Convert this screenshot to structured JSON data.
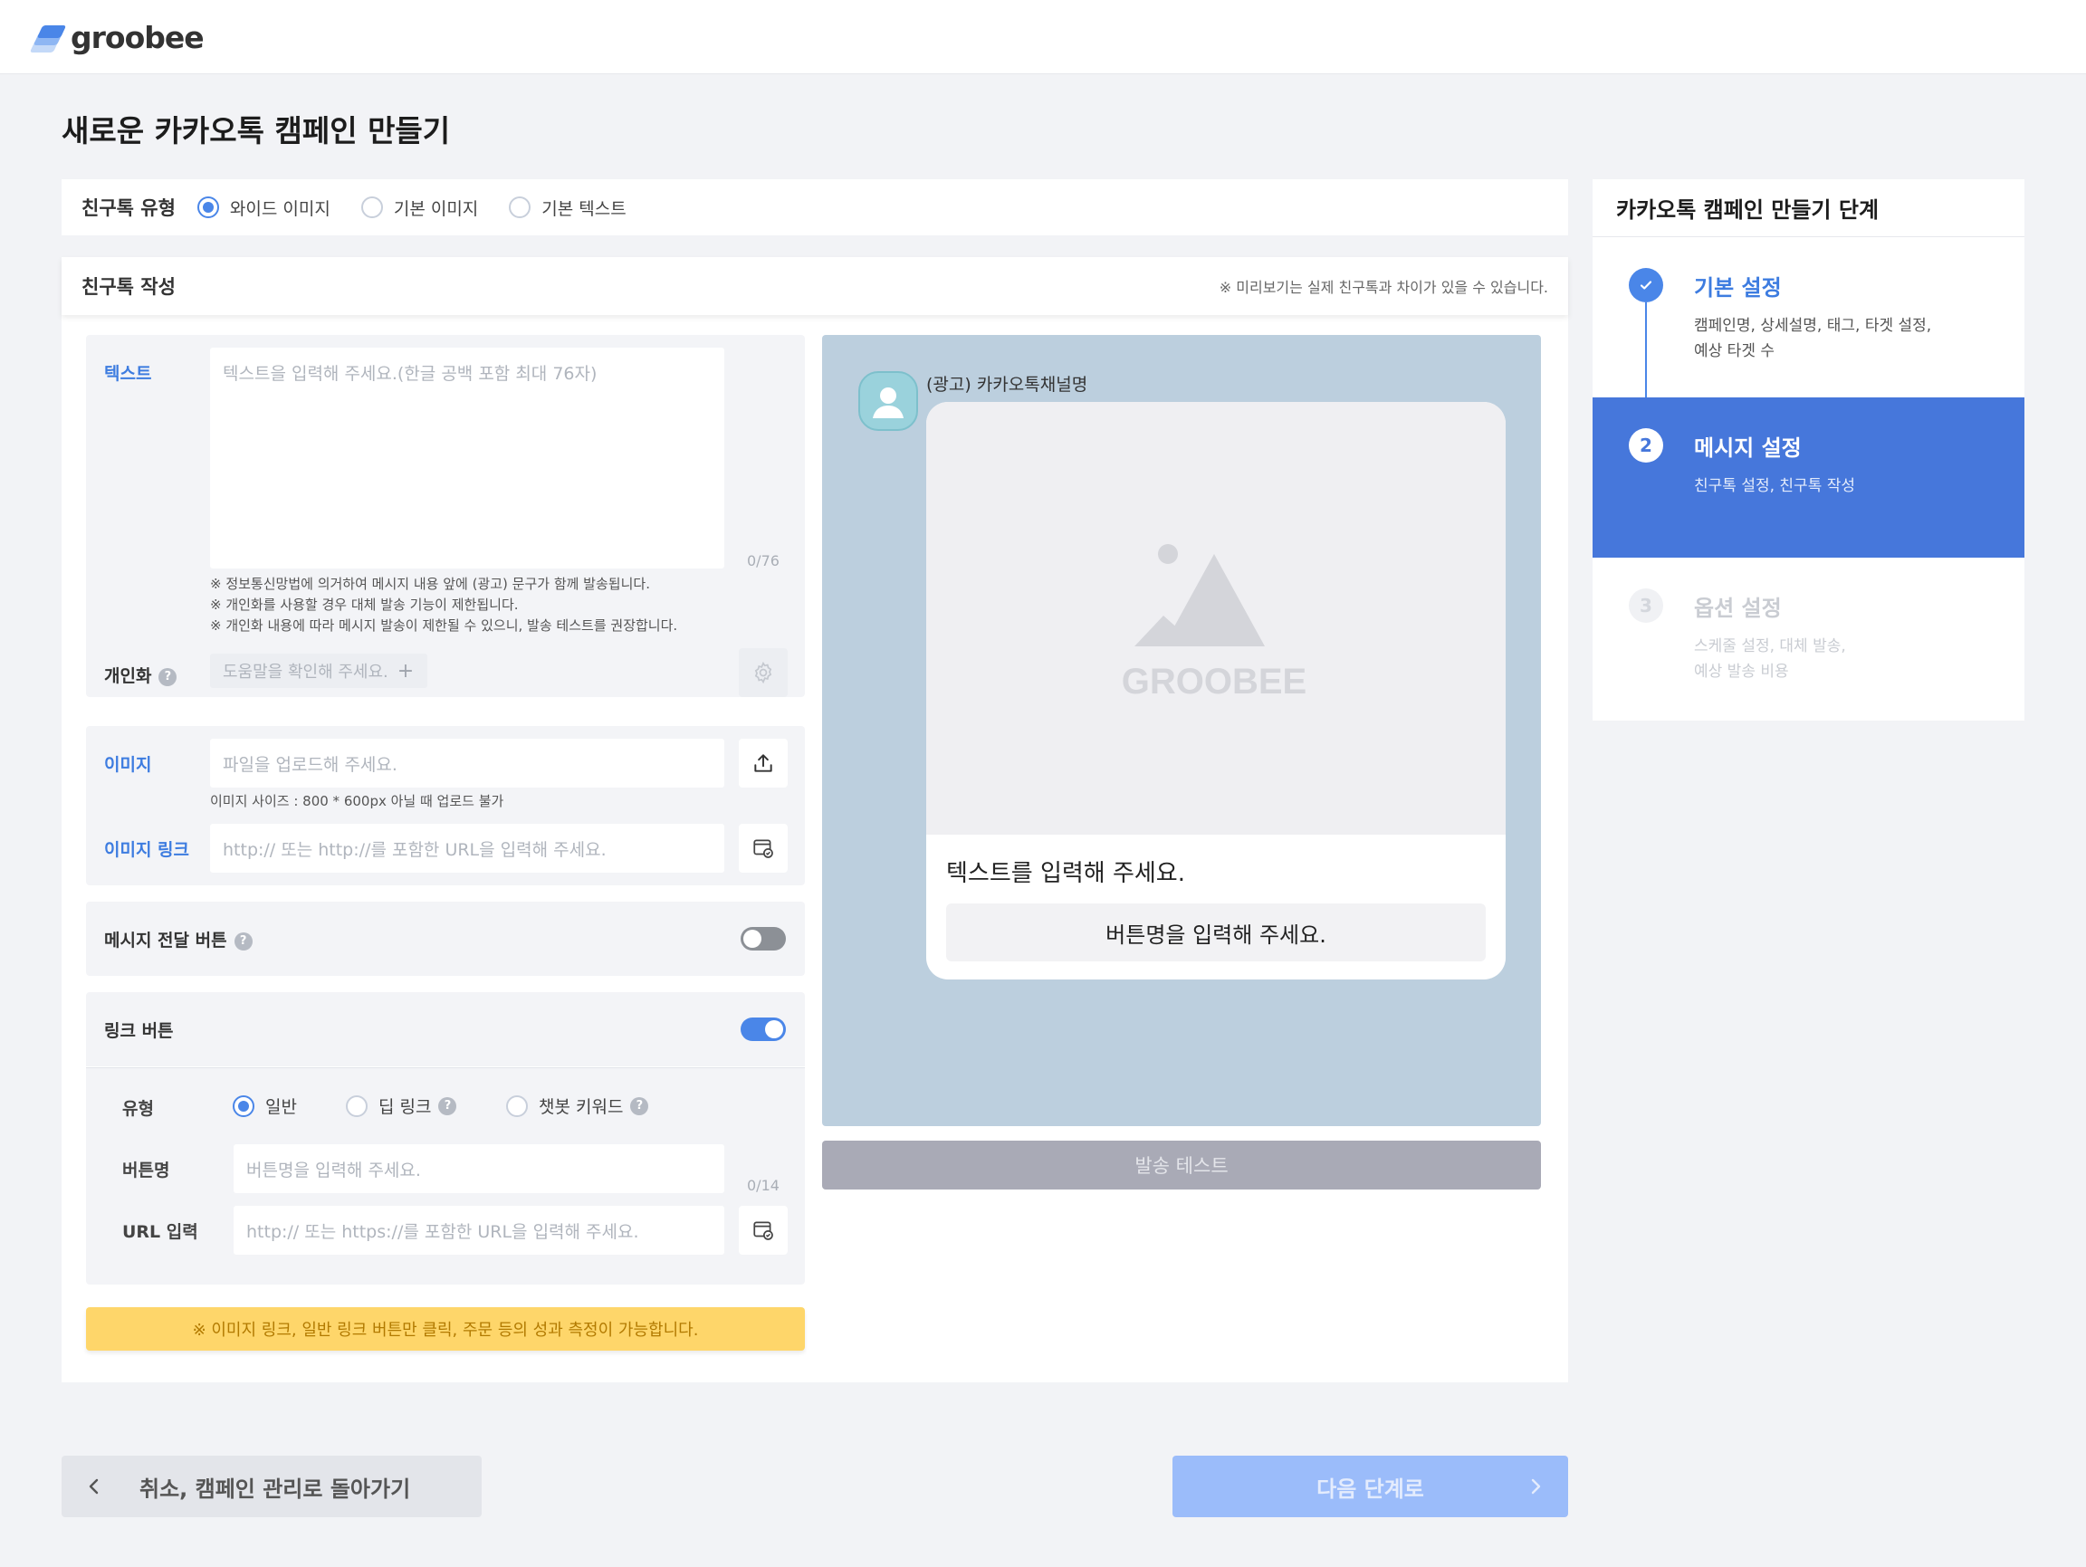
{
  "brand": {
    "name": "groobee"
  },
  "page": {
    "title": "새로운 카카오톡 캠페인 만들기"
  },
  "message_type": {
    "label": "친구톡 유형",
    "options": [
      "와이드 이미지",
      "기본 이미지",
      "기본 텍스트"
    ],
    "selected": "와이드 이미지"
  },
  "compose": {
    "title": "친구톡 작성",
    "preview_note": "※ 미리보기는 실제 친구톡과 차이가 있을 수 있습니다.",
    "text": {
      "label": "텍스트",
      "placeholder": "텍스트을 입력해 주세요.(한글 공백 포함 최대 76자)",
      "counter": "0/76",
      "notes": [
        "※ 정보통신망법에 의거하여 메시지 내용 앞에 (광고) 문구가 함께 발송됩니다.",
        "※ 개인화를 사용할 경우 대체 발송 기능이 제한됩니다.",
        "※ 개인화 내용에 따라 메시지 발송이 제한될 수 있으니, 발송 테스트를 권장합니다."
      ]
    },
    "personalization": {
      "label": "개인화",
      "help": "?",
      "placeholder": "도움말을 확인해 주세요.",
      "add_symbol": "+"
    },
    "image": {
      "label": "이미지",
      "placeholder": "파일을 업로드해 주세요.",
      "note": "이미지 사이즈 : 800 * 600px 아닐 때 업로드 불가"
    },
    "image_link": {
      "label": "이미지 링크",
      "placeholder": "http:// 또는 http://를 포함한 URL을 입력해 주세요."
    },
    "message_button": {
      "label": "메시지 전달 버튼",
      "help": "?",
      "enabled": false
    },
    "link_button": {
      "label": "링크 버튼",
      "enabled": true,
      "type_label": "유형",
      "types": [
        {
          "label": "일반",
          "help": ""
        },
        {
          "label": "딥 링크",
          "help": "?"
        },
        {
          "label": "챗봇 키워드",
          "help": "?"
        }
      ],
      "selected_type": "일반",
      "name_label": "버튼명",
      "name_placeholder": "버튼명을 입력해 주세요.",
      "name_counter": "0/14",
      "url_label": "URL 입력",
      "url_placeholder": "http:// 또는 https://를 포함한 URL을 입력해 주세요."
    },
    "banner": "※ 이미지 링크, 일반 링크 버튼만 클릭, 주문 등의 성과 측정이 가능합니다."
  },
  "preview": {
    "channel_name": "(광고) 카카오톡채널명",
    "image_watermark": "GROOBEE",
    "text": "텍스트를 입력해 주세요.",
    "button": "버튼명을 입력해 주세요.",
    "test_button": "발송 테스트"
  },
  "steps": {
    "title": "카카오톡 캠페인 만들기 단계",
    "items": [
      {
        "number": "",
        "status": "done",
        "name": "기본 설정",
        "desc": "캠페인명, 상세설명, 태그, 타겟 설정,\n예상 타겟 수"
      },
      {
        "number": "2",
        "status": "active",
        "name": "메시지 설정",
        "desc": "친구톡 설정, 친구톡 작성"
      },
      {
        "number": "3",
        "status": "pending",
        "name": "옵션 설정",
        "desc": "스케줄 설정, 대체 발송,\n예상 발송 비용"
      }
    ]
  },
  "footer": {
    "back": "취소, 캠페인 관리로 돌아가기",
    "next": "다음 단계로"
  },
  "colors": {
    "accent": "#4a86e8",
    "active_step": "#4677db",
    "preview_bg": "#bccfde",
    "banner": "#fed66a",
    "next_disabled": "#9bbcfa"
  }
}
